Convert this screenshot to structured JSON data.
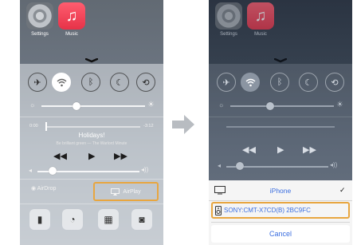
{
  "left_phone": {
    "apps": [
      {
        "label": "Settings",
        "icon": "settings-icon"
      },
      {
        "label": "Music",
        "icon": "music-note-icon"
      }
    ],
    "toggles": [
      {
        "icon": "airplane-icon",
        "on": false
      },
      {
        "icon": "wifi-icon",
        "on": true
      },
      {
        "icon": "bluetooth-icon",
        "on": false
      },
      {
        "icon": "moon-icon",
        "on": false
      },
      {
        "icon": "rotation-lock-icon",
        "on": false
      }
    ],
    "brightness": 0.4,
    "music": {
      "elapsed": "0:00",
      "remaining": "-3:12",
      "title": "Holidays!",
      "subtitle": "Be brilliant green — The Warlord Minute",
      "progress": 0.0
    },
    "volume": 0.15,
    "airdrop_label": "AirDrop",
    "airplay_label": "AirPlay",
    "bottom_buttons": [
      "flashlight-icon",
      "timer-icon",
      "calculator-icon",
      "camera-icon"
    ]
  },
  "right_phone": {
    "apps": [
      {
        "label": "Settings",
        "icon": "settings-icon"
      },
      {
        "label": "Music",
        "icon": "music-note-icon"
      }
    ],
    "brightness": 0.48,
    "volume": 0.14,
    "airplay_sheet": {
      "devices": [
        {
          "name": "iPhone",
          "icon": "monitor-icon",
          "selected": true,
          "check": "✓"
        },
        {
          "name": "SONY:CMT-X7CD(B) 2BC9FC",
          "icon": "speaker-icon",
          "selected": false
        }
      ],
      "cancel_label": "Cancel"
    }
  },
  "colors": {
    "highlight": "#e8a640",
    "sheet_text": "#3c6fe0"
  }
}
